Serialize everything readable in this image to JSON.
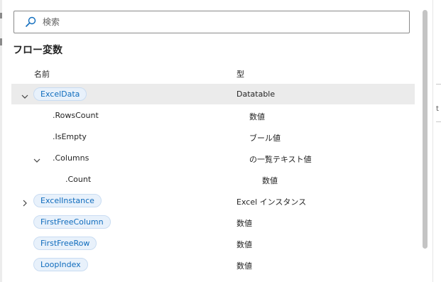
{
  "search": {
    "placeholder": "検索",
    "value": ""
  },
  "section_title": "フロー変数",
  "columns": {
    "name": "名前",
    "type": "型"
  },
  "rows": [
    {
      "name": "ExcelData",
      "type": "Datatable",
      "pill": true,
      "expanded": true,
      "selected": true
    },
    {
      "name": ".RowsCount",
      "type": "数値"
    },
    {
      "name": ".IsEmpty",
      "type": "ブール値"
    },
    {
      "name": ".Columns",
      "type": "の一覧テキスト値",
      "expanded": true
    },
    {
      "name": ".Count",
      "type": "数値"
    },
    {
      "name": "ExcelInstance",
      "type": "Excel インスタンス",
      "pill": true,
      "expanded": false
    },
    {
      "name": "FirstFreeColumn",
      "type": "数値",
      "pill": true
    },
    {
      "name": "FirstFreeRow",
      "type": "数値",
      "pill": true
    },
    {
      "name": "LoopIndex",
      "type": "数値",
      "pill": true
    }
  ],
  "right_edge_glyph": "t",
  "colors": {
    "accent": "#0f6cbd",
    "pill_bg": "#e8f1fb",
    "selected_row": "#ebebeb"
  },
  "icons": {
    "search": "search-icon",
    "expanded": "chevron-down-icon",
    "collapsed": "chevron-right-icon"
  }
}
